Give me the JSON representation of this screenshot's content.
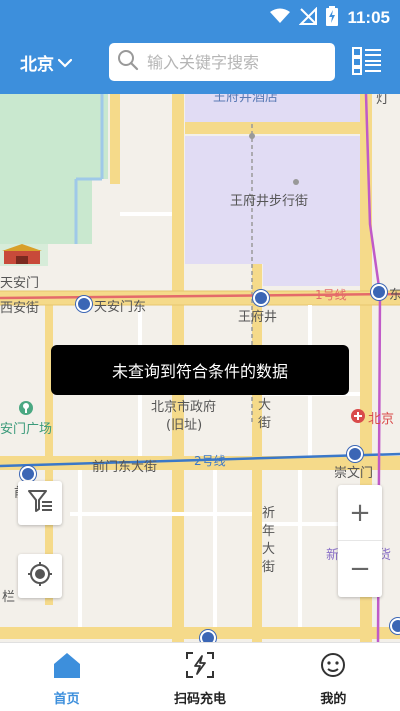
{
  "status_bar": {
    "time": "11:05",
    "icons": [
      "wifi-icon",
      "no-signal-icon",
      "battery-charging-icon"
    ]
  },
  "header": {
    "city": "北京",
    "search_placeholder": "输入关键字搜索",
    "icons": [
      "chevron-down-icon",
      "search-icon",
      "list-icon"
    ]
  },
  "map": {
    "labels": {
      "wangfujing_street": "王府井步行街",
      "tiananmen": "天安门",
      "xi_an_street": "西安街",
      "tiananmen_east": "天安门东",
      "wangfujing": "王府井",
      "line1": "1号线",
      "dong": "东",
      "city_gov": "北京市政府",
      "old_site": "(旧址)",
      "da": "大",
      "jie": "街",
      "beijing_station": "北京",
      "tiananmen_square": "安门广场",
      "qianmen_east": "前门东大街",
      "line2": "2号线",
      "chongwenmen": "崇文门",
      "qian": "前",
      "qi": "祈",
      "nian": "年",
      "da2": "大",
      "jie2": "街",
      "new_world": "新世界百货",
      "lan": "栏",
      "top_partial": "王府井酒店",
      "top_right": "灯"
    },
    "toast": "未查询到符合条件的数据"
  },
  "controls": {
    "zoom_in": "+",
    "zoom_out": "−"
  },
  "tabbar": {
    "tabs": [
      {
        "label": "首页",
        "icon": "home-icon",
        "active": true
      },
      {
        "label": "扫码充电",
        "icon": "scan-charge-icon",
        "active": false
      },
      {
        "label": "我的",
        "icon": "profile-icon",
        "active": false
      }
    ]
  },
  "colors": {
    "primary": "#3d8fdc",
    "toast_bg": "#000000",
    "line1": "#e46a6a",
    "line2": "#3b78c8",
    "metro": "#3b66b5"
  }
}
